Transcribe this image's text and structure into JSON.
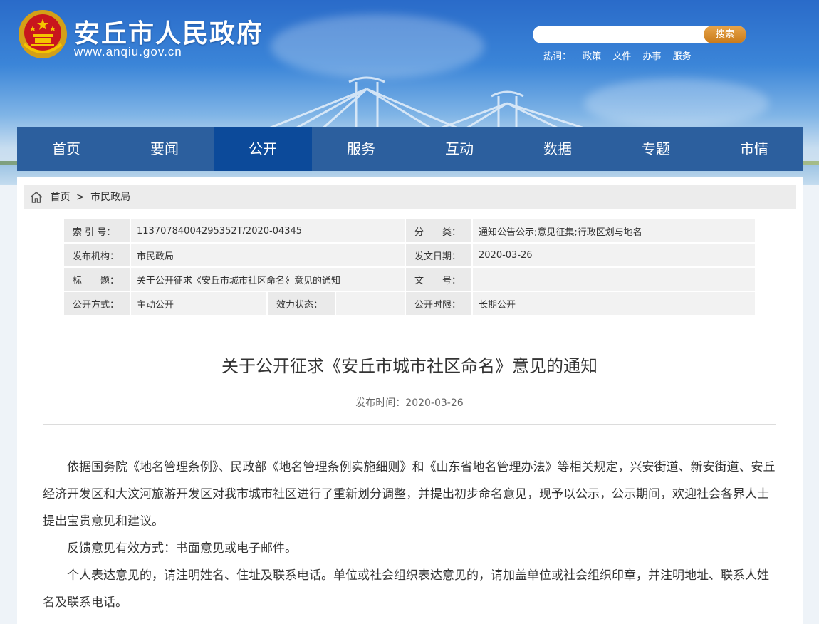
{
  "header": {
    "site_title": "安丘市人民政府",
    "site_url": "www.anqiu.gov.cn",
    "search": {
      "placeholder": "",
      "button_label": "搜索"
    },
    "hotwords": {
      "label": "热词：",
      "items": [
        "政策",
        "文件",
        "办事",
        "服务"
      ]
    }
  },
  "nav": {
    "items": [
      "首页",
      "要闻",
      "公开",
      "服务",
      "互动",
      "数据",
      "专题",
      "市情"
    ],
    "active_index": 2
  },
  "breadcrumb": {
    "home": "首页",
    "separator": ">",
    "current": "市民政局"
  },
  "meta": {
    "index_label": "索 引 号：",
    "index_value": "11370784004295352T/2020-04345",
    "category_label": "分　　类：",
    "category_value": "通知公告公示;意见征集;行政区划与地名",
    "issuer_label": "发布机构：",
    "issuer_value": "市民政局",
    "date_label": "发文日期：",
    "date_value": "2020-03-26",
    "title_label": "标　　题：",
    "title_value": "关于公开征求《安丘市城市社区命名》意见的通知",
    "docno_label": "文　　号：",
    "docno_value": "",
    "mode_label": "公开方式：",
    "mode_value": "主动公开",
    "status_label": "效力状态：",
    "status_value": "",
    "term_label": "公开时限：",
    "term_value": "长期公开"
  },
  "article": {
    "title": "关于公开征求《安丘市城市社区命名》意见的通知",
    "pubdate": "发布时间：2020-03-26",
    "paragraphs": [
      "依据国务院《地名管理条例》、民政部《地名管理条例实施细则》和《山东省地名管理办法》等相关规定，兴安街道、新安街道、安丘经济开发区和大汶河旅游开发区对我市城市社区进行了重新划分调整，并提出初步命名意见，现予以公示，公示期间，欢迎社会各界人士提出宝贵意见和建议。",
      "反馈意见有效方式：书面意见或电子邮件。",
      "个人表达意见的，请注明姓名、住址及联系电话。单位或社会组织表达意见的，请加盖单位或社会组织印章，并注明地址、联系人姓名及联系电话。"
    ]
  },
  "colors": {
    "nav_bg": "#2c5f9e",
    "nav_active": "#0c4a9a",
    "search_button": "#d98b2b"
  }
}
